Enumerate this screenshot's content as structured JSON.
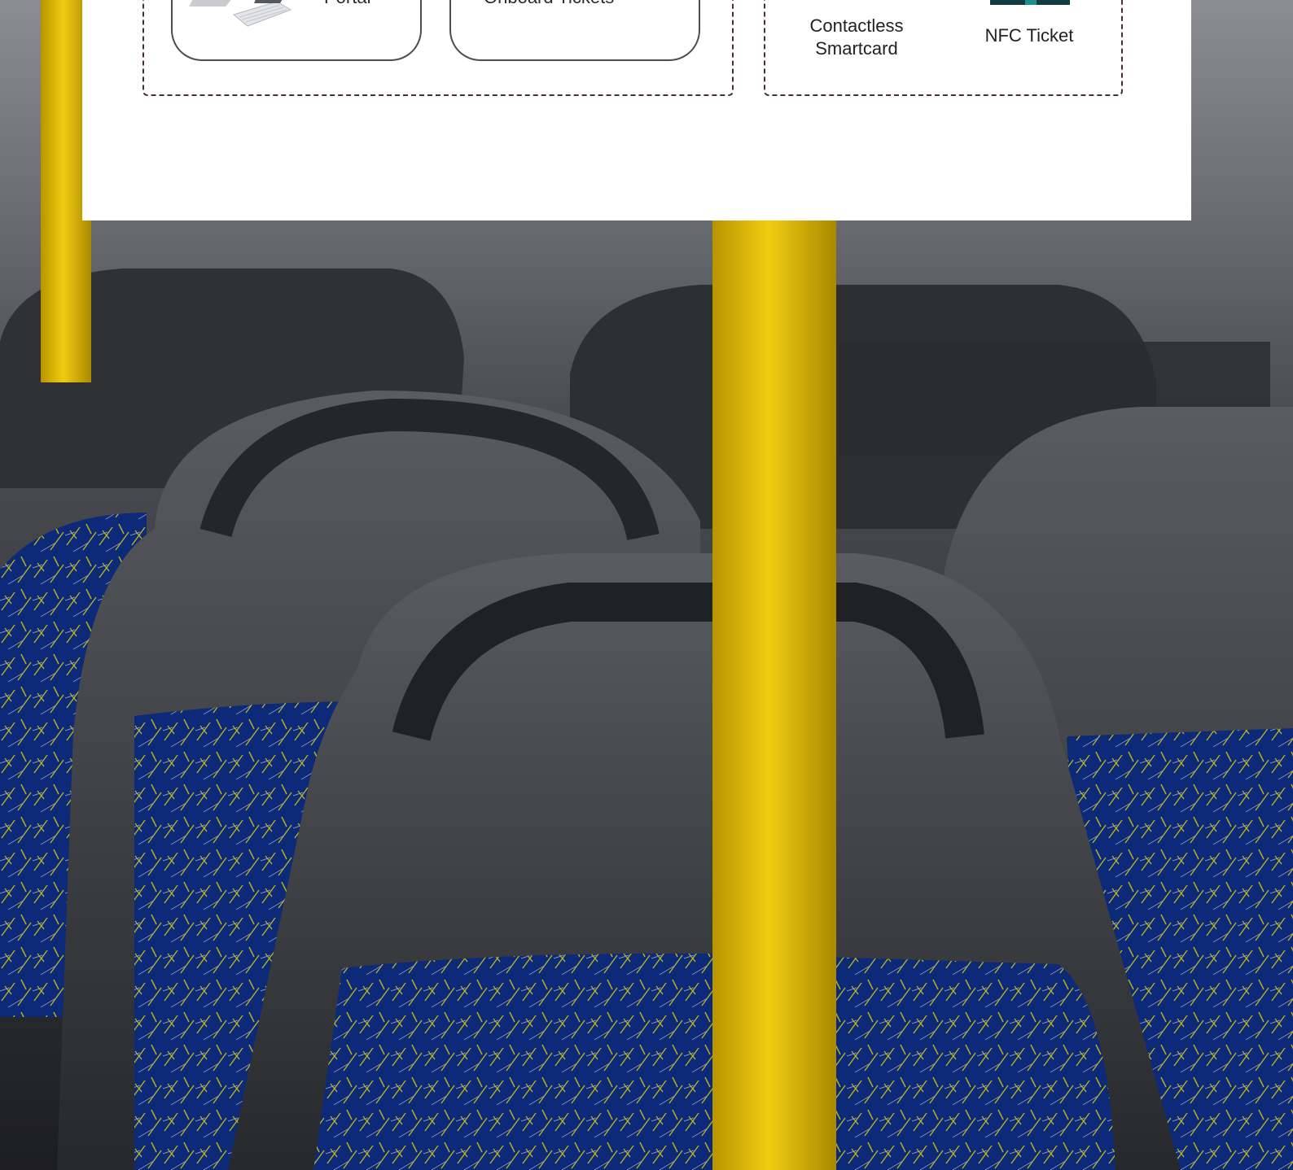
{
  "panel": {
    "cards": [
      {
        "label": "Portal"
      },
      {
        "label": "Onboard Tickets"
      }
    ],
    "options": [
      {
        "label": "Contactless Smartcard"
      },
      {
        "label": "NFC Ticket"
      }
    ]
  },
  "colors": {
    "pole": "#e1b800",
    "seat_shell": "#3a3c40",
    "seat_fabric": "#0c2a7a",
    "dash_border": "#4a2f2a",
    "nfc_icon": "#123c3c"
  }
}
